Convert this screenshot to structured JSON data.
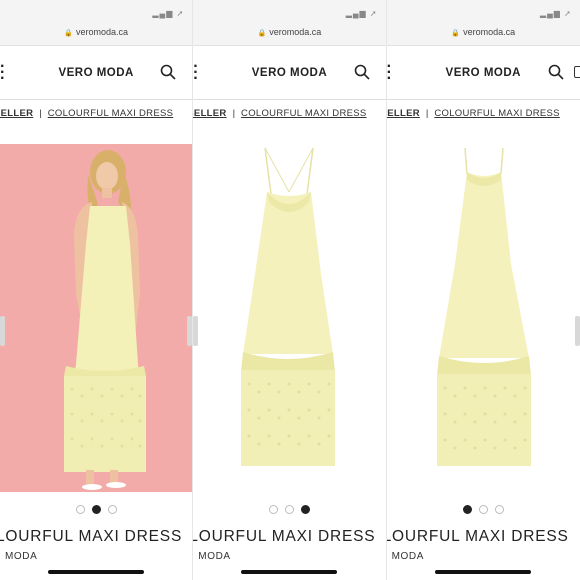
{
  "browser": {
    "url": "veromoda.ca",
    "status_icons": "▂▄▆ ➚"
  },
  "header": {
    "logo": "VERO MODA"
  },
  "breadcrumb": {
    "crumb": "SELLER",
    "separator": "|",
    "current": "COLOURFUL MAXI DRESS"
  },
  "product": {
    "title": "LOURFUL MAXI DRESS",
    "brand": "MODA"
  },
  "colors": {
    "dress": "#f3f0b8",
    "photo_background": "#f2a5a8"
  },
  "panels": [
    {
      "image": "model-photo",
      "active_dot": 2
    },
    {
      "image": "dress-front",
      "active_dot": 3
    },
    {
      "image": "dress-back",
      "active_dot": 1
    }
  ]
}
